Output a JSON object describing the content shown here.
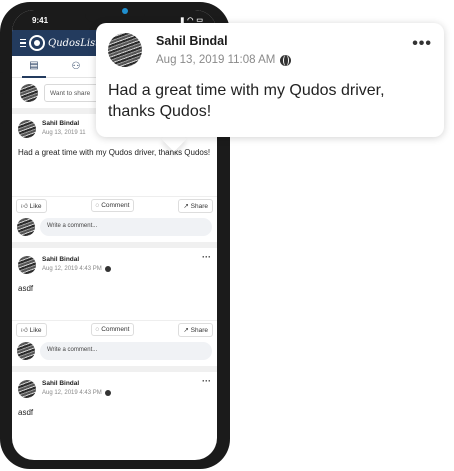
{
  "status_bar": {
    "time": "9:41"
  },
  "app": {
    "logo_text": "QudosList"
  },
  "composer": {
    "placeholder": "Want to share"
  },
  "posts": [
    {
      "author": "Sahil Bindal",
      "date": "Aug 13, 2019 11",
      "text": "Had a great time with my Qudos driver, thanks Qudos!"
    },
    {
      "author": "Sahil Bindal",
      "date": "Aug 12, 2019 4:43 PM",
      "text": "asdf"
    },
    {
      "author": "Sahil Bindal",
      "date": "Aug 12, 2019 4:43 PM",
      "text": "asdf"
    }
  ],
  "actions": {
    "like": "Like",
    "comment": "Comment",
    "share": "Share"
  },
  "comment_placeholder": "Write a comment...",
  "popup": {
    "author": "Sahil Bindal",
    "date": "Aug 13, 2019 11:08 AM",
    "text": "Had a great time with my Qudos driver, thanks Qudos!",
    "more": "•••"
  },
  "colors": {
    "brand": "#233b5e",
    "camera": "#1f8fcf"
  }
}
